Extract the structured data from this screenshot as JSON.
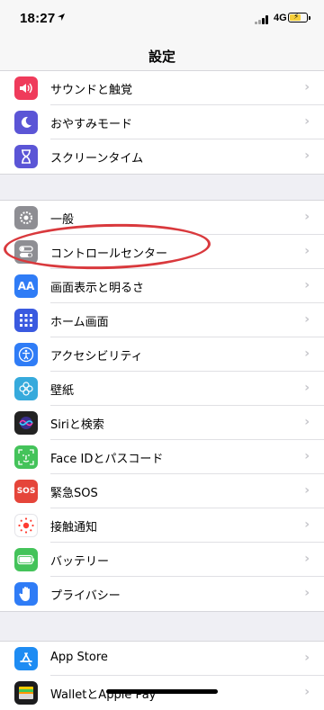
{
  "status": {
    "time": "18:27",
    "network": "4G"
  },
  "nav": {
    "title": "設定"
  },
  "groups": [
    {
      "items": [
        {
          "label": "サウンドと触覚",
          "icon": "speaker-icon",
          "color": "#ef3b5b"
        },
        {
          "label": "おやすみモード",
          "icon": "moon-icon",
          "color": "#5b55d6"
        },
        {
          "label": "スクリーンタイム",
          "icon": "hourglass-icon",
          "color": "#5b55d6"
        }
      ]
    },
    {
      "items": [
        {
          "label": "一般",
          "icon": "gear-icon",
          "color": "#8e8e93"
        },
        {
          "label": "コントロールセンター",
          "icon": "toggles-icon",
          "color": "#8e8e93"
        },
        {
          "label": "画面表示と明るさ",
          "icon": "text-size-icon",
          "color": "#2f7cf6"
        },
        {
          "label": "ホーム画面",
          "icon": "grid-icon",
          "color": "#3a5ae0"
        },
        {
          "label": "アクセシビリティ",
          "icon": "accessibility-icon",
          "color": "#2f7cf6"
        },
        {
          "label": "壁紙",
          "icon": "flower-icon",
          "color": "#36aadc"
        },
        {
          "label": "Siriと検索",
          "icon": "siri-icon",
          "color": "#222222"
        },
        {
          "label": "Face IDとパスコード",
          "icon": "face-id-icon",
          "color": "#44c35a"
        },
        {
          "label": "緊急SOS",
          "icon": "sos-icon",
          "color": "#e5453a",
          "icon_text": "SOS"
        },
        {
          "label": "接触通知",
          "icon": "exposure-icon",
          "color": "#ffffff"
        },
        {
          "label": "バッテリー",
          "icon": "battery-icon",
          "color": "#44c35a"
        },
        {
          "label": "プライバシー",
          "icon": "hand-icon",
          "color": "#2f7cf6"
        }
      ]
    },
    {
      "items": [
        {
          "label": "App Store",
          "icon": "app-store-icon",
          "color": "#1e8cf3"
        },
        {
          "label": "WalletとApple Pay",
          "icon": "wallet-icon",
          "color": "#1c1c1e"
        }
      ]
    }
  ],
  "accent": {
    "highlight": "#d9393d",
    "chevron": "#c7c7cc"
  }
}
